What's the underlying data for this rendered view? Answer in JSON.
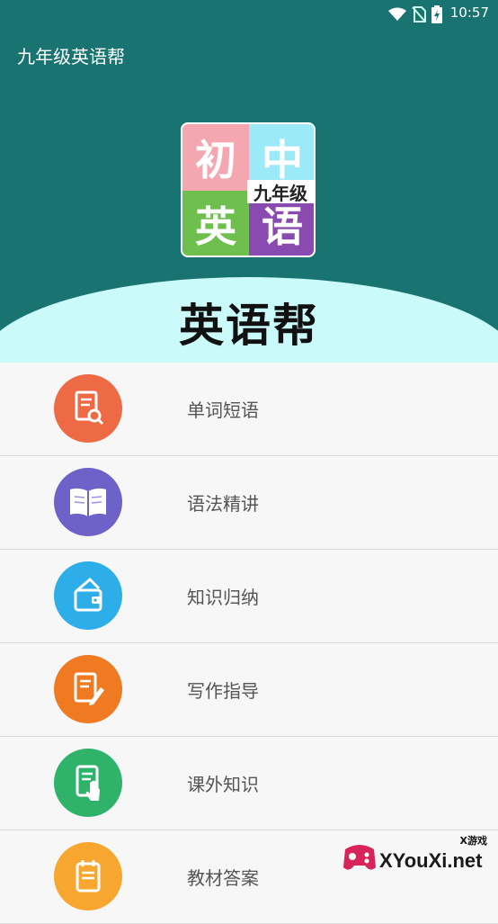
{
  "status": {
    "time": "10:57"
  },
  "appbar": {
    "title": "九年级英语帮"
  },
  "logo": {
    "q1": "初",
    "q2": "中",
    "q3": "英",
    "q4": "语",
    "grade": "九年级"
  },
  "brand": "英语帮",
  "items": [
    {
      "label": "单词短语",
      "icon": "document-search-icon",
      "color": "#ee6a45"
    },
    {
      "label": "语法精讲",
      "icon": "book-icon",
      "color": "#6e62c8"
    },
    {
      "label": "知识归纳",
      "icon": "wallet-icon",
      "color": "#2eaee8"
    },
    {
      "label": "写作指导",
      "icon": "document-pen-icon",
      "color": "#f07a22"
    },
    {
      "label": "课外知识",
      "icon": "tablet-hand-icon",
      "color": "#2fb36b"
    },
    {
      "label": "教材答案",
      "icon": "notepad-icon",
      "color": "#f7a730"
    }
  ],
  "watermark": {
    "text": "XYouXi.net",
    "small": "X游戏"
  }
}
